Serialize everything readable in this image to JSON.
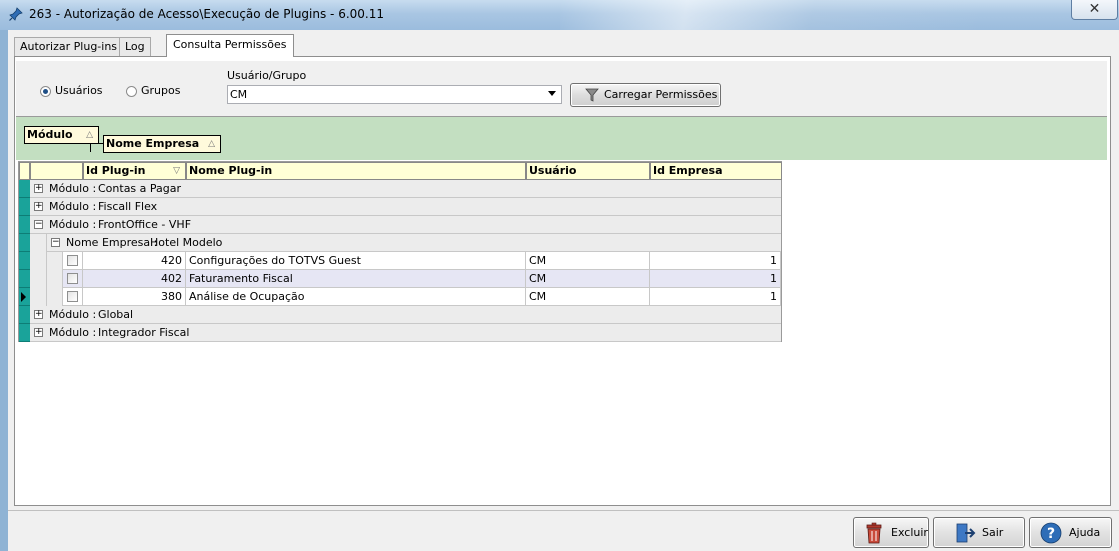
{
  "window": {
    "title": "263 - Autorização de Acesso\\Execução de Plugins - 6.00.11",
    "close_symbol": "✕"
  },
  "tabs": [
    {
      "label": "Autorizar Plug-ins"
    },
    {
      "label": "Log"
    },
    {
      "label": "Consulta Permissões",
      "active": true
    }
  ],
  "filter": {
    "radio_users": "Usuários",
    "radio_groups": "Grupos",
    "selected_radio": "Usuários",
    "group_label": "Usuário/Grupo",
    "group_value": "CM",
    "load_button": "Carregar Permissões"
  },
  "group_by": {
    "chip1": "Módulo",
    "chip2": "Nome Empresa",
    "sort_glyph": "△"
  },
  "grid": {
    "columns": {
      "id": "Id Plug-in",
      "name": "Nome Plug-in",
      "user": "Usuário",
      "company": "Id Empresa"
    },
    "sort_glyph": "▽",
    "module_prefix": "Módulo : ",
    "modules": [
      "Contas a Pagar",
      "Fiscall Flex",
      "FrontOffice - VHF",
      "Global",
      "Integrador Fiscal"
    ],
    "company_prefix": "Nome Empresa : ",
    "company": "Hotel Modelo",
    "rows": [
      {
        "id": "420",
        "name": "Configurações do TOTVS Guest",
        "user": "CM",
        "company": "1"
      },
      {
        "id": "402",
        "name": "Faturamento Fiscal",
        "user": "CM",
        "company": "1"
      },
      {
        "id": "380",
        "name": "Análise de Ocupação",
        "user": "CM",
        "company": "1"
      }
    ]
  },
  "buttons": {
    "delete": "Excluir",
    "exit": "Sair",
    "help": "Ajuda"
  },
  "colors": {
    "indicator": "#1aa39a",
    "group_band": "#c3dfc1",
    "header": "#ffffd6",
    "selected_row": "#e6e6f4"
  }
}
